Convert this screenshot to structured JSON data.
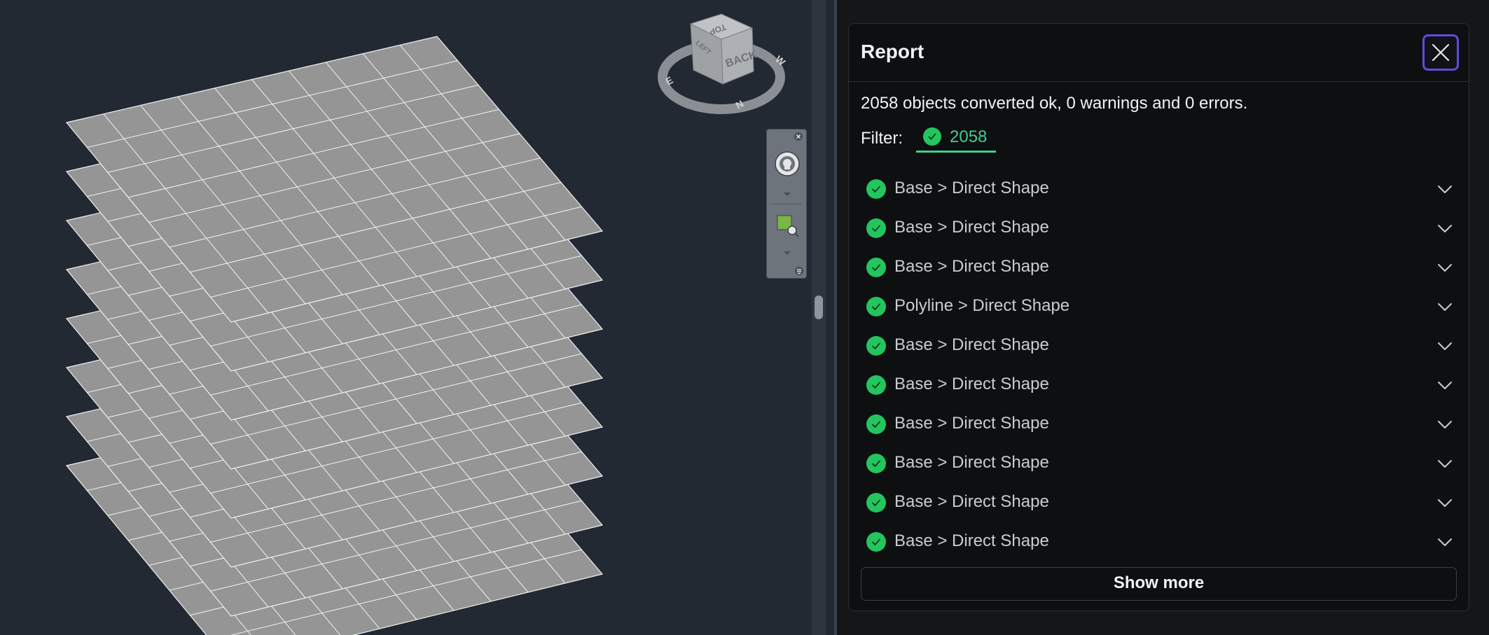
{
  "viewcube": {
    "top_label": "TOP",
    "back_label": "BACK",
    "side_label": "LEFT",
    "compass": {
      "n": "N",
      "e": "E",
      "w": "W"
    }
  },
  "report": {
    "title": "Report",
    "summary": "2058 objects converted ok, 0 warnings and 0 errors.",
    "filter_label": "Filter:",
    "filter_count": "2058",
    "items": [
      {
        "label": "Base > Direct Shape"
      },
      {
        "label": "Base > Direct Shape"
      },
      {
        "label": "Base > Direct Shape"
      },
      {
        "label": "Polyline > Direct Shape"
      },
      {
        "label": "Base > Direct Shape"
      },
      {
        "label": "Base > Direct Shape"
      },
      {
        "label": "Base > Direct Shape"
      },
      {
        "label": "Base > Direct Shape"
      },
      {
        "label": "Base > Direct Shape"
      },
      {
        "label": "Base > Direct Shape"
      }
    ],
    "show_more_label": "Show more"
  },
  "colors": {
    "viewport_bg": "#222933",
    "panel_bg": "#0e0f11",
    "success": "#22c55e",
    "filter_accent": "#3fcf8e",
    "focus_ring": "#5a4ee0",
    "layer_fill": "#959595"
  }
}
